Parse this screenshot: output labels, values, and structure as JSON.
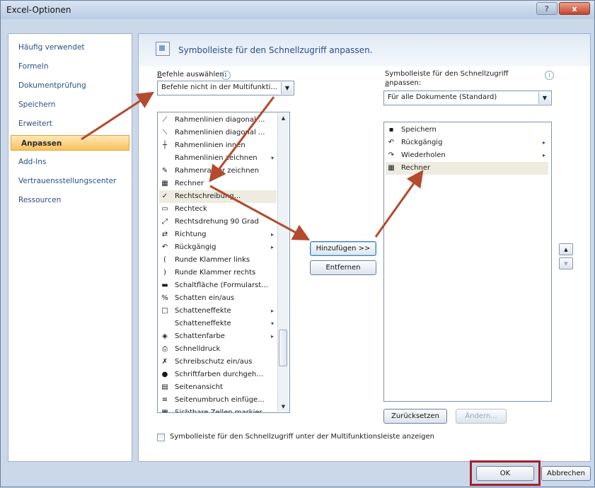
{
  "window": {
    "title": "Excel-Optionen",
    "help_label": "?",
    "close_label": "x"
  },
  "nav": {
    "items": [
      {
        "label": "Häufig verwendet",
        "selected": false
      },
      {
        "label": "Formeln",
        "selected": false
      },
      {
        "label": "Dokumentprüfung",
        "selected": false
      },
      {
        "label": "Speichern",
        "selected": false
      },
      {
        "label": "Erweitert",
        "selected": false
      },
      {
        "label": "Anpassen",
        "selected": true
      },
      {
        "label": "Add-Ins",
        "selected": false
      },
      {
        "label": "Vertrauensstellungscenter",
        "selected": false
      },
      {
        "label": "Ressourcen",
        "selected": false
      }
    ]
  },
  "header": {
    "title": "Symbolleiste für den Schnellzugriff anpassen."
  },
  "commands": {
    "label_prefix": "B",
    "label_rest": "efehle auswählen:",
    "combo_value": "Befehle nicht in der Multifunkti...",
    "items": [
      {
        "icon": "diagonal-border-icon",
        "glyph": "⟋",
        "label": "Rahmenlinien diagonal ...",
        "submenu": ""
      },
      {
        "icon": "diagonal-border-down-icon",
        "glyph": "⟍",
        "label": "Rahmenlinien diagonal ...",
        "submenu": ""
      },
      {
        "icon": "inner-borders-icon",
        "glyph": "┼",
        "label": "Rahmenlinien innen",
        "submenu": ""
      },
      {
        "icon": "",
        "glyph": "",
        "label": "Rahmenlinien zeichnen",
        "submenu": "▾"
      },
      {
        "icon": "draw-border-icon",
        "glyph": "✎",
        "label": "Rahmenraster zeichnen",
        "submenu": ""
      },
      {
        "icon": "calculator-icon",
        "glyph": "▦",
        "label": "Rechner",
        "submenu": ""
      },
      {
        "icon": "spellcheck-icon",
        "glyph": "✓",
        "label": "Rechtschreibung...",
        "submenu": ""
      },
      {
        "icon": "rectangle-icon",
        "glyph": "▭",
        "label": "Rechteck",
        "submenu": ""
      },
      {
        "icon": "rotate-text-icon",
        "glyph": "⤢",
        "label": "Rechtsdrehung 90 Grad",
        "submenu": ""
      },
      {
        "icon": "direction-icon",
        "glyph": "⇄",
        "label": "Richtung",
        "submenu": "▸"
      },
      {
        "icon": "undo-icon",
        "glyph": "↶",
        "label": "Rückgängig",
        "submenu": "▸"
      },
      {
        "icon": "open-paren-icon",
        "glyph": "(",
        "label": "Runde Klammer links",
        "submenu": ""
      },
      {
        "icon": "close-paren-icon",
        "glyph": ")",
        "label": "Runde Klammer rechts",
        "submenu": ""
      },
      {
        "icon": "form-button-icon",
        "glyph": "▬",
        "label": "Schaltfläche (Formularst...",
        "submenu": ""
      },
      {
        "icon": "shadow-toggle-icon",
        "glyph": "%",
        "label": "Schatten ein/aus",
        "submenu": ""
      },
      {
        "icon": "shadow-effects-icon",
        "glyph": "□",
        "label": "Schatteneffekte",
        "submenu": "▸"
      },
      {
        "icon": "",
        "glyph": "",
        "label": "Schatteneffekte",
        "submenu": "▾"
      },
      {
        "icon": "shadow-color-icon",
        "glyph": "◈",
        "label": "Schattenfarbe",
        "submenu": "▸"
      },
      {
        "icon": "quick-print-icon",
        "glyph": "⎙",
        "label": "Schnelldruck",
        "submenu": ""
      },
      {
        "icon": "write-protect-icon",
        "glyph": "✗",
        "label": "Schreibschutz ein/aus",
        "submenu": ""
      },
      {
        "icon": "font-color-icon",
        "glyph": "●",
        "label": "Schriftfarben durchgeh...",
        "submenu": ""
      },
      {
        "icon": "page-view-icon",
        "glyph": "▤",
        "label": "Seitenansicht",
        "submenu": ""
      },
      {
        "icon": "page-break-icon",
        "glyph": "≡",
        "label": "Seitenumbruch einfüge...",
        "submenu": ""
      },
      {
        "icon": "visible-cells-icon",
        "glyph": "▦",
        "label": "Sichtbare Zellen markier...",
        "submenu": ""
      }
    ]
  },
  "toolbar": {
    "label_line1": "Symbolleiste für den Schnellzugriff",
    "label_line2_underlined": "a",
    "label_line2_rest": "npassen:",
    "combo_value": "Für alle Dokumente (Standard)",
    "items": [
      {
        "icon": "save-icon",
        "glyph": "▪",
        "label": "Speichern",
        "submenu": ""
      },
      {
        "icon": "undo-icon",
        "glyph": "↶",
        "label": "Rückgängig",
        "submenu": "▸"
      },
      {
        "icon": "redo-icon",
        "glyph": "↷",
        "label": "Wiederholen",
        "submenu": "▸"
      },
      {
        "icon": "calculator-icon",
        "glyph": "▦",
        "label": "Rechner",
        "submenu": ""
      }
    ]
  },
  "buttons": {
    "add": "Hinzufügen >>",
    "remove": "Entfernen",
    "reset": "Zurücksetzen",
    "modify": "Ändern...",
    "ok": "OK",
    "cancel": "Abbrechen",
    "move_up": "▲",
    "move_down": "▼"
  },
  "options": {
    "show_below_ribbon": "Symbolleiste für den Schnellzugriff unter der Multifunktionsleiste anzeigen"
  },
  "colors": {
    "annotation": "#b44a2e",
    "ok_frame": "#a2212a",
    "selected_nav": "#f9c25d"
  }
}
